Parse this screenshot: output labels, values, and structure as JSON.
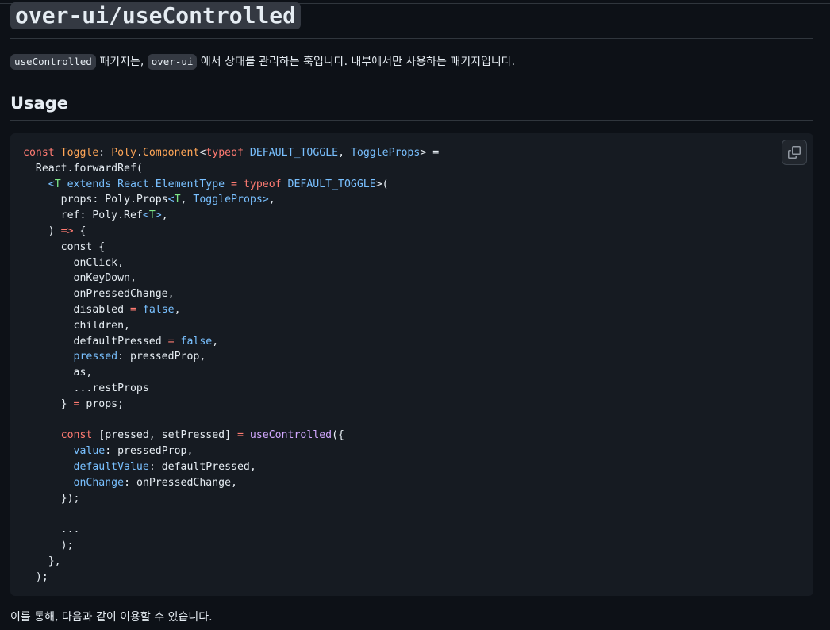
{
  "title": "over-ui/useControlled",
  "intro": {
    "code1": "useControlled",
    "text1": " 패키지는, ",
    "code2": "over-ui",
    "text2": " 에서 상태를 관리하는 훅입니다. 내부에서만 사용하는 패키지입니다."
  },
  "usage_heading": "Usage",
  "code_block": {
    "copy_icon": "copy-icon",
    "lines": [
      [
        {
          "t": "const",
          "s": "k"
        },
        {
          "t": " "
        },
        {
          "t": "Toggle",
          "s": "t"
        },
        {
          "t": ": "
        },
        {
          "t": "Poly",
          "s": "t"
        },
        {
          "t": "."
        },
        {
          "t": "Component",
          "s": "t"
        },
        {
          "t": "<"
        },
        {
          "t": "typeof",
          "s": "k"
        },
        {
          "t": " "
        },
        {
          "t": "DEFAULT_TOGGLE",
          "s": "c"
        },
        {
          "t": ", "
        },
        {
          "t": "ToggleProps",
          "s": "c"
        },
        {
          "t": "> ="
        }
      ],
      [
        {
          "t": "  React.forwardRef("
        }
      ],
      [
        {
          "t": "    "
        },
        {
          "t": "<",
          "s": "c"
        },
        {
          "t": "T",
          "s": "g"
        },
        {
          "t": " extends React.",
          "s": "c"
        },
        {
          "t": "ElementType",
          "s": "c"
        },
        {
          "t": " = ",
          "s": "k"
        },
        {
          "t": "typeof",
          "s": "k"
        },
        {
          "t": " "
        },
        {
          "t": "DEFAULT_TOGGLE",
          "s": "c"
        },
        {
          "t": ">("
        }
      ],
      [
        {
          "t": "      props: Poly.Props"
        },
        {
          "t": "<",
          "s": "c"
        },
        {
          "t": "T",
          "s": "g"
        },
        {
          "t": ", "
        },
        {
          "t": "ToggleProps",
          "s": "c"
        },
        {
          "t": ">",
          "s": "c"
        },
        {
          "t": ","
        }
      ],
      [
        {
          "t": "      ref: Poly.Ref"
        },
        {
          "t": "<",
          "s": "c"
        },
        {
          "t": "T",
          "s": "g"
        },
        {
          "t": ">",
          "s": "c"
        },
        {
          "t": ","
        }
      ],
      [
        {
          "t": "    ) "
        },
        {
          "t": "=>",
          "s": "k"
        },
        {
          "t": " {"
        }
      ],
      [
        {
          "t": "      const {"
        }
      ],
      [
        {
          "t": "        onClick,"
        }
      ],
      [
        {
          "t": "        onKeyDown,"
        }
      ],
      [
        {
          "t": "        onPressedChange,"
        }
      ],
      [
        {
          "t": "        disabled "
        },
        {
          "t": "=",
          "s": "k"
        },
        {
          "t": " "
        },
        {
          "t": "false",
          "s": "c"
        },
        {
          "t": ","
        }
      ],
      [
        {
          "t": "        children,"
        }
      ],
      [
        {
          "t": "        defaultPressed "
        },
        {
          "t": "=",
          "s": "k"
        },
        {
          "t": " "
        },
        {
          "t": "false",
          "s": "c"
        },
        {
          "t": ","
        }
      ],
      [
        {
          "t": "        "
        },
        {
          "t": "pressed",
          "s": "c"
        },
        {
          "t": ": pressedProp,"
        }
      ],
      [
        {
          "t": "        as,"
        }
      ],
      [
        {
          "t": "        ...restProps"
        }
      ],
      [
        {
          "t": "      } "
        },
        {
          "t": "=",
          "s": "k"
        },
        {
          "t": " props;"
        }
      ],
      [
        {
          "t": ""
        }
      ],
      [
        {
          "t": "      "
        },
        {
          "t": "const",
          "s": "k"
        },
        {
          "t": " [pressed, setPressed] "
        },
        {
          "t": "=",
          "s": "k"
        },
        {
          "t": " "
        },
        {
          "t": "useControlled",
          "s": "f"
        },
        {
          "t": "({"
        }
      ],
      [
        {
          "t": "        "
        },
        {
          "t": "value",
          "s": "c"
        },
        {
          "t": ": pressedProp,"
        }
      ],
      [
        {
          "t": "        "
        },
        {
          "t": "defaultValue",
          "s": "c"
        },
        {
          "t": ": defaultPressed,"
        }
      ],
      [
        {
          "t": "        "
        },
        {
          "t": "onChange",
          "s": "c"
        },
        {
          "t": ": onPressedChange,"
        }
      ],
      [
        {
          "t": "      });"
        }
      ],
      [
        {
          "t": ""
        }
      ],
      [
        {
          "t": "      ..."
        }
      ],
      [
        {
          "t": "      );"
        }
      ],
      [
        {
          "t": "    },"
        }
      ],
      [
        {
          "t": "  );"
        }
      ]
    ]
  },
  "outro": "이를 통해, 다음과 같이 이용할 수 있습니다."
}
